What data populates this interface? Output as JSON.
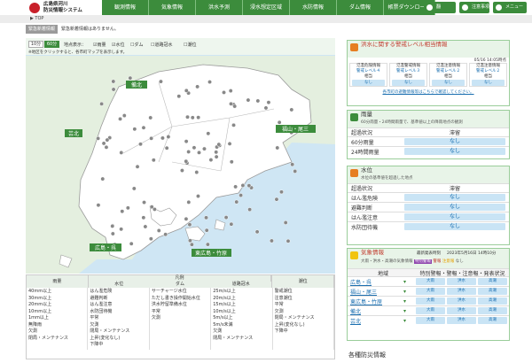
{
  "header": {
    "logo_line1": "広島県河川",
    "logo_line2": "防災情報システム",
    "nav": [
      "観測情報",
      "気象情報",
      "洪水予測",
      "浸水想定区域",
      "水防情報",
      "ダム情報",
      "帳票ダウンロード"
    ],
    "translate": "翻訳/Lang",
    "caution": "注意事項",
    "menu": "メニュー"
  },
  "breadcrumb": "▶ TOP",
  "notice": {
    "label": "緊急新着情報",
    "text": "緊急新着情報はありません。"
  },
  "map": {
    "toggle": [
      "10分",
      "60分"
    ],
    "display_label": "地点表示：",
    "checkboxes": [
      "雨量",
      "水位",
      "ダム",
      "道路冠水",
      "潮位"
    ],
    "hint": "※地区をクリックすると、各市町マップを表示します。",
    "regions": [
      "備北",
      "芸北",
      "福山・尾三",
      "広島・呉",
      "東広島・竹原"
    ]
  },
  "legend": {
    "title": "凡例",
    "headers": [
      "雨量",
      "水位",
      "ダム",
      "道路冠水",
      "潮位"
    ],
    "rain": [
      "40mm以上",
      "30mm以上",
      "20mm以上",
      "10mm以上",
      "1mm以上",
      "無降雨",
      "欠測",
      "閉局・メンテナンス"
    ],
    "level": [
      "はん濫危険",
      "避難判断",
      "はん濫注意",
      "水防団待機",
      "平常",
      "欠測",
      "閉局・メンテナンス",
      "上昇(変化なし)",
      "下降中"
    ],
    "dam": [
      "サーチャージ水位",
      "ただし書き操作開始水位",
      "洪水貯留準備水位",
      "平常",
      "欠測"
    ],
    "road": [
      "25m/s以上",
      "20m/s以上",
      "15m/s以上",
      "10m/s以上",
      "5m/s以上",
      "5m/s未満",
      "欠測",
      "閉局・メンテナンス"
    ],
    "tide": [
      "警戒潮位",
      "注意潮位",
      "平常",
      "欠測",
      "閉局・メンテナンス",
      "上昇(変化なし)",
      "下降中"
    ]
  },
  "flood": {
    "title": "洪水に関する警戒レベル相当情報",
    "time": "05/16 14:05時点",
    "cols": [
      [
        "氾濫危険情報",
        "警戒レベル４",
        "相当"
      ],
      [
        "氾濫警戒情報",
        "警戒レベル３",
        "相当"
      ],
      [
        "氾濫注意情報",
        "警戒レベル２",
        "相当"
      ],
      [
        "氾濫注意情報",
        "警戒レベル２",
        "相当"
      ]
    ],
    "vals": [
      "なし",
      "なし",
      "なし",
      "なし"
    ],
    "link": "各市町の避難情報等はこちらで確認してください。"
  },
  "rain": {
    "title": "雨量",
    "sub": "60分雨量・24時間雨量で、基準値以上の降雨地点の観測",
    "h1": "超過状況",
    "h2": "滞留",
    "rows": [
      {
        "label": "60分雨量",
        "value": "なし"
      },
      {
        "label": "24時間雨量",
        "value": "なし"
      }
    ]
  },
  "water": {
    "title": "水位",
    "sub": "水位の基準値を超過した地点",
    "h1": "超過状況",
    "h2": "滞留",
    "rows": [
      {
        "label": "はん濫危険",
        "value": "なし"
      },
      {
        "label": "避難判断",
        "value": "なし"
      },
      {
        "label": "はん濫注意",
        "value": "なし"
      },
      {
        "label": "水防団待機",
        "value": "なし"
      }
    ]
  },
  "weather": {
    "title": "気象情報",
    "latest": "最新発表時刻",
    "time": "2023年5月16日 14時10分",
    "legend": "大雨・洪水・高潮の気象情報",
    "t1": "特別警報",
    "t2": "警報",
    "t3": "注意報",
    "t4": "なし",
    "h1": "地域",
    "h2": "特別警報・警報・注意報・発表状況",
    "rows": [
      {
        "name": "広島・呉",
        "b": [
          "大雨",
          "洪水",
          "高潮"
        ]
      },
      {
        "name": "福山・尾三",
        "b": [
          "大雨",
          "洪水",
          "高潮"
        ]
      },
      {
        "name": "東広島・竹原",
        "b": [
          "大雨",
          "洪水",
          "高潮"
        ]
      },
      {
        "name": "備北",
        "b": [
          "大雨",
          "洪水",
          "高潮"
        ]
      },
      {
        "name": "芸北",
        "b": [
          "大雨",
          "洪水",
          "高潮"
        ]
      }
    ]
  },
  "various": "各種防災情報",
  "colors": {
    "accent": "#3c8c3c",
    "link_btn": "#c9e4f5",
    "warn": "#c0392b"
  }
}
